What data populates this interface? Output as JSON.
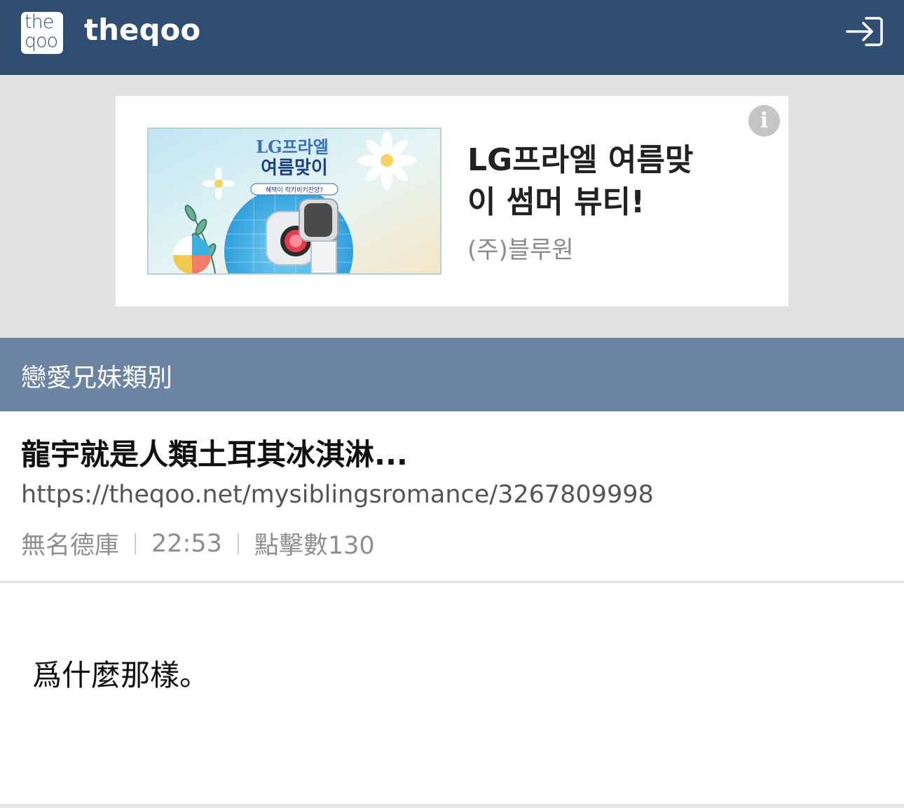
{
  "header": {
    "logo_text_top": "the",
    "logo_text_bottom": "qoo",
    "site_name": "theqoo",
    "login_icon": "login-icon",
    "bg_color": "#2f4e72"
  },
  "ad": {
    "image_headline_1": "LG프라엘",
    "image_headline_2": "여름맞이",
    "image_sub": "혜택이 럭키비키잔앙?",
    "title": "LG프라엘 여름맞이 썸머 뷰티!",
    "company": "(주)블루원",
    "info_icon": "info-icon"
  },
  "category": {
    "label": "戀愛兄妹類別",
    "bg_color": "#6b84a2"
  },
  "post": {
    "title": "龍宇就是人類土耳其冰淇淋...",
    "url": "https://theqoo.net/mysiblingsromance/3267809998",
    "author": "無名德庫",
    "time": "22:53",
    "views": "點擊數130",
    "body": "爲什麼那樣。"
  }
}
